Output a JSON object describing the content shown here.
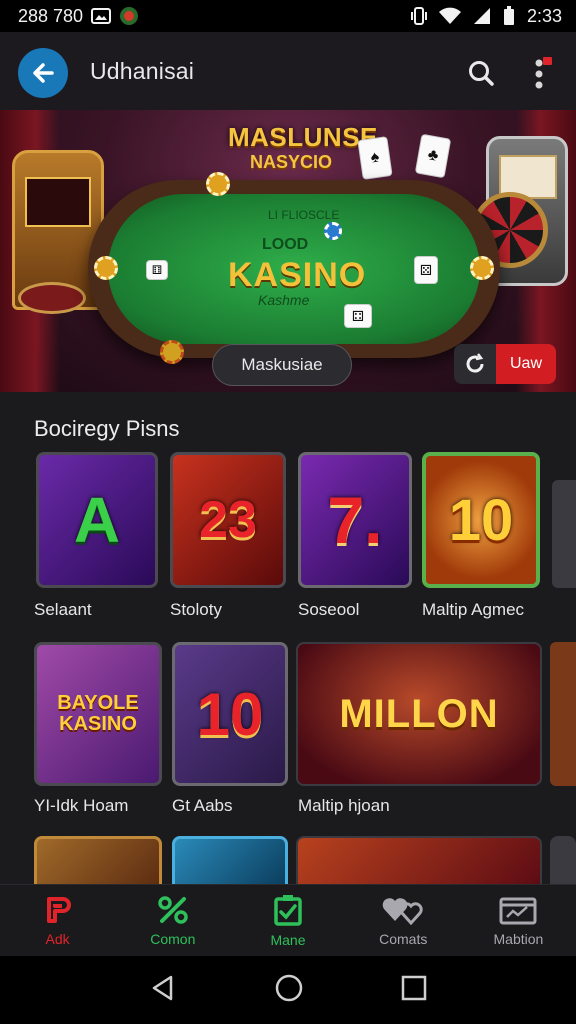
{
  "status_bar": {
    "time_left": "288 780",
    "time_right": "2:33",
    "icons": [
      "photo-icon",
      "app-badge-icon",
      "vibrate-icon",
      "wifi-icon",
      "signal-icon",
      "battery-icon"
    ]
  },
  "app_bar": {
    "title": "Udhanisai",
    "back_icon": "arrow-left-icon",
    "search_icon": "search-icon",
    "more_icon": "more-vert-icon",
    "accent": "#1878b8"
  },
  "hero": {
    "headline_1": "MASLUNSE",
    "headline_2": "NASYCIO",
    "felt_top": "LI FLIOSCLE",
    "felt_small": "LOOD",
    "felt_main": "KASINO",
    "felt_sub": "Kashme",
    "pill_label": "Maskusiae",
    "toggle_label": "Uaw",
    "toggle_color": "#d21e22"
  },
  "section": {
    "title": "Bociregy Pisns"
  },
  "games_row_1": [
    {
      "label": "Selaant",
      "art": "A"
    },
    {
      "label": "Stoloty",
      "art": "23"
    },
    {
      "label": "Soseool",
      "art": "7."
    },
    {
      "label": "Maltip Agmec",
      "art": "10"
    }
  ],
  "games_row_2": [
    {
      "label": "YI-Idk Hoam",
      "art": "BAYOLE KASINO"
    },
    {
      "label": "Gt Aabs",
      "art": "10"
    },
    {
      "label": "Maltip hjoan",
      "art": "MILLON"
    }
  ],
  "bottom_nav": [
    {
      "label": "Adk",
      "icon": "p-logo-icon",
      "color": "#e0242a"
    },
    {
      "label": "Comon",
      "icon": "percent-icon",
      "color": "#2ec05a"
    },
    {
      "label": "Mane",
      "icon": "check-box-icon",
      "color": "#2ec05a"
    },
    {
      "label": "Comats",
      "icon": "hearts-icon",
      "color": "#a8a8ae"
    },
    {
      "label": "Mabtion",
      "icon": "wallet-icon",
      "color": "#a8a8ae"
    }
  ],
  "system_nav": {
    "back_icon": "nav-back-icon",
    "home_icon": "nav-home-icon",
    "recents_icon": "nav-recents-icon"
  }
}
